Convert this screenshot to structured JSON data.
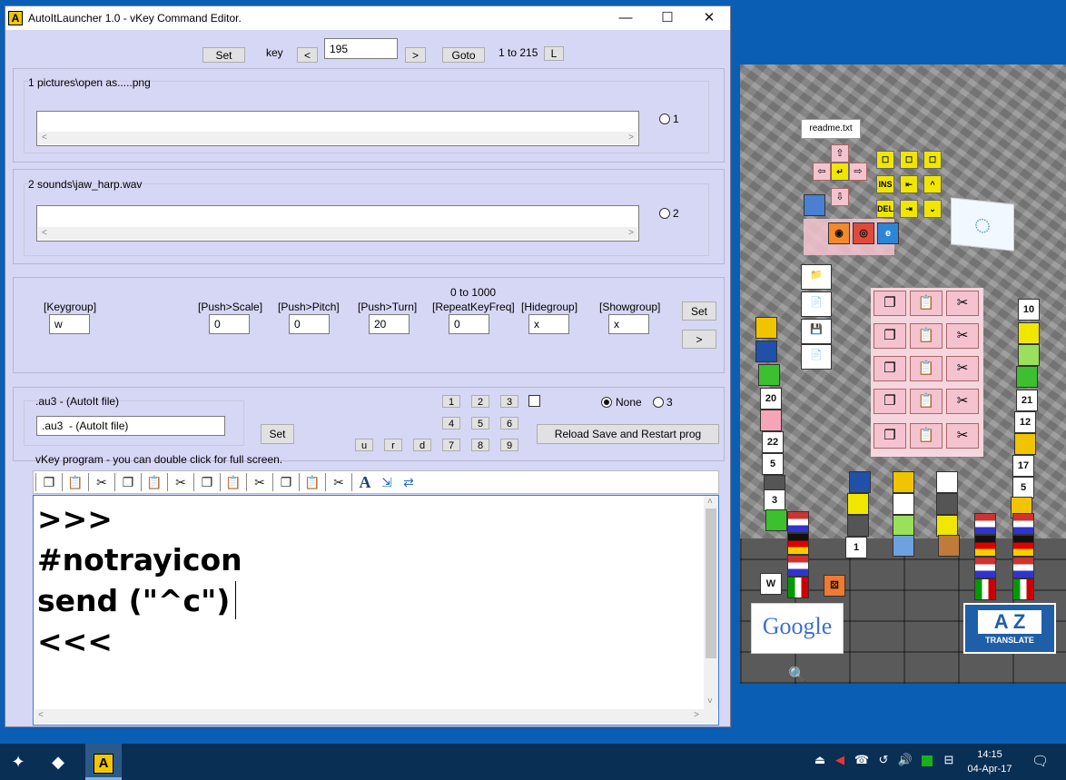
{
  "window": {
    "title": "AutoItLauncher 1.0 - vKey Command Editor.",
    "minimize": "—",
    "maximize": "☐",
    "close": "✕"
  },
  "top_bar": {
    "set_label": "Set",
    "key_label": "key",
    "prev_label": "<",
    "key_value": "195",
    "next_label": ">",
    "goto_label": "Goto",
    "range_label": "1 to 215",
    "l_label": "L"
  },
  "pictures": {
    "title": "1 pictures\\open as.....png",
    "value": "",
    "radio_label": "1"
  },
  "sounds": {
    "title": "2 sounds\\jaw_harp.wav",
    "value": "",
    "radio_label": "2"
  },
  "params": {
    "range_note": "0  to 1000",
    "keygroup": {
      "label": "[Keygroup]",
      "value": "w"
    },
    "push_scale": {
      "label": "[Push>Scale]",
      "value": "0"
    },
    "push_pitch": {
      "label": "[Push>Pitch]",
      "value": "0"
    },
    "push_turn": {
      "label": "[Push>Turn]",
      "value": "20"
    },
    "repeat": {
      "label": "[RepeatKeyFreq]",
      "value": "0"
    },
    "hidegroup": {
      "label": "[Hidegroup]",
      "value": "x"
    },
    "showgroup": {
      "label": "[Showgroup]",
      "value": "x"
    },
    "set_label": "Set",
    "next_label": ">"
  },
  "au3": {
    "group_title": ".au3  - (AutoIt file)",
    "value": ".au3  - (AutoIt file)",
    "set_label": "Set",
    "num_buttons": [
      "1",
      "2",
      "3",
      "4",
      "5",
      "6",
      "7",
      "8",
      "9"
    ],
    "letter_buttons": [
      "u",
      "r",
      "d"
    ],
    "none_label": "None",
    "three_label": "3",
    "reload_label": "Reload Save and Restart prog"
  },
  "program": {
    "caption": "vKey  program - you can double click for full screen.",
    "lines": [
      ">>>",
      "#notrayicon",
      "send (\"^c\")",
      "<<<"
    ]
  },
  "scene": {
    "readme": "readme.txt",
    "google": "Google",
    "translate_top": "A Z",
    "translate_bottom": "TRANSLATE",
    "keys": [
      "INS",
      "DEL"
    ],
    "cube_labels": [
      "20",
      "22",
      "5",
      "3",
      "10",
      "21",
      "12",
      "17",
      "5",
      "1"
    ]
  },
  "taskbar": {
    "time": "14:15",
    "date": "04-Apr-17"
  }
}
